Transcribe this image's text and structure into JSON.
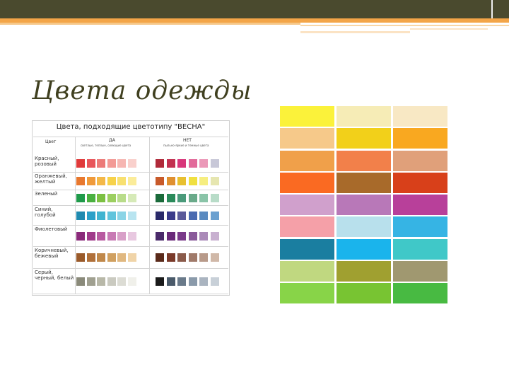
{
  "slide": {
    "title": "Цвета одежды"
  },
  "table": {
    "title": "Цвета, подходящие цветотипу \"ВЕСНА\"",
    "col_color": "Цвет",
    "col_yes": "ДА",
    "col_yes_sub": "светлые, теплые, сияющие цвета",
    "col_no": "НЕТ",
    "col_no_sub": "пыльно-яркие и темные цвета",
    "rows": [
      {
        "label": "Красный, розовый",
        "yes": [
          "#e03a3a",
          "#e8555a",
          "#ec7a78",
          "#f39a96",
          "#f6b6b2",
          "#f9d0cc"
        ],
        "no": [
          "#b02a3a",
          "#c23050",
          "#d8367a",
          "#e26a9a",
          "#eb98b8",
          "#c8c8d8"
        ]
      },
      {
        "label": "Оранжевый, желтый",
        "yes": [
          "#e8782e",
          "#f09a3a",
          "#f4b848",
          "#f7d24a",
          "#f8e070",
          "#fbec9a"
        ],
        "no": [
          "#c85a2a",
          "#e09030",
          "#e8c030",
          "#f0e040",
          "#f6ee80",
          "#e6e6b0"
        ]
      },
      {
        "label": "Зеленый",
        "yes": [
          "#1f9a4a",
          "#4ab040",
          "#7cc042",
          "#9ccf60",
          "#b8dc8a",
          "#d6eab8"
        ],
        "no": [
          "#1a6a3a",
          "#2a8a5a",
          "#4a9a7a",
          "#6aaa8a",
          "#8ac4a8",
          "#b8dcc8"
        ]
      },
      {
        "label": "Синий, голубой",
        "yes": [
          "#1f8ab0",
          "#2aa0c8",
          "#40b4d0",
          "#60c4dc",
          "#8ad4e6",
          "#b8e4f0"
        ],
        "no": [
          "#2a2a6a",
          "#3a3a8a",
          "#5a5a9a",
          "#4a6ab0",
          "#5a8ac0",
          "#6aa0d0"
        ]
      },
      {
        "label": "Фиолетовый",
        "yes": [
          "#8a2a7a",
          "#a03a8a",
          "#b85aa0",
          "#c87ab4",
          "#d8a0c8",
          "#e8c8e0"
        ],
        "no": [
          "#4a2a6a",
          "#6a2a7a",
          "#7a3a8a",
          "#8a5a9a",
          "#aa8ab8",
          "#c8b0d0"
        ]
      },
      {
        "label": "Коричневый, бежевый",
        "yes": [
          "#9a5a2a",
          "#b0703a",
          "#c0884a",
          "#d0a060",
          "#e0b880",
          "#f0d4a8"
        ],
        "no": [
          "#5a2a1a",
          "#7a3a2a",
          "#8a5a4a",
          "#a07a6a",
          "#b89a8a",
          "#d0b8a8"
        ]
      },
      {
        "label": "Серый, черный, белый",
        "yes": [
          "#8a8a7a",
          "#a0a090",
          "#b8b8a8",
          "#cacac0",
          "#dcdcd4",
          "#f0f0ea"
        ],
        "no": [
          "#1a1a1a",
          "#4a5a6a",
          "#6a7a8a",
          "#8a9aaa",
          "#aab4c0",
          "#c8d0d8"
        ]
      }
    ]
  },
  "palette": {
    "rows": [
      [
        "#fbf23a",
        "#f6ecb6",
        "#f8e8c4"
      ],
      [
        "#f6c98a",
        "#f2d01a",
        "#f9a820"
      ],
      [
        "#f0a04a",
        "#f2804a",
        "#e0a07a"
      ],
      [
        "#fa6a22",
        "#a86a2a",
        "#d8401a"
      ],
      [
        "#d0a0cc",
        "#b878b8",
        "#b8409a"
      ],
      [
        "#f5a0a8",
        "#b8e0ec",
        "#36b4e4"
      ],
      [
        "#1a7ea0",
        "#1ab4ec",
        "#40c8c8"
      ],
      [
        "#c0d880",
        "#a0a030",
        "#a09870"
      ],
      [
        "#88d448",
        "#78c432",
        "#48ba42"
      ]
    ]
  }
}
